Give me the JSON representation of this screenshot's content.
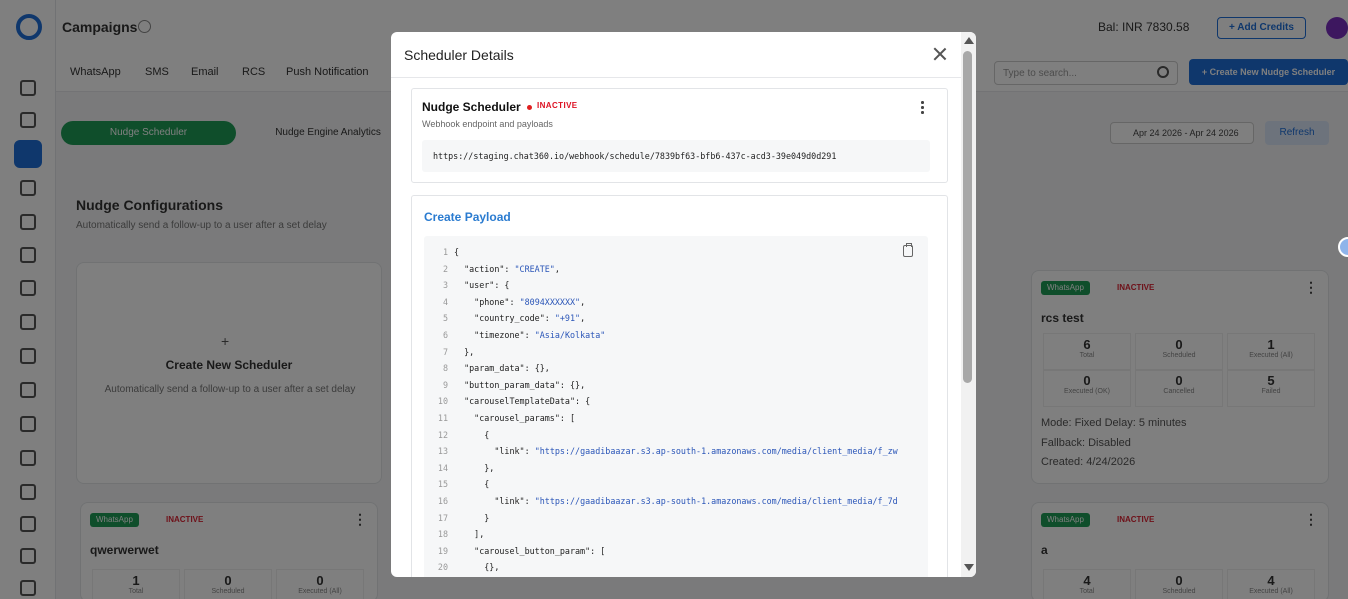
{
  "app": {
    "page_title": "Campaigns",
    "balance": "Bal: INR 7830.58",
    "add_credits": "+ Add Credits",
    "channel_tabs": [
      "WhatsApp",
      "SMS",
      "Email",
      "RCS",
      "Push Notification"
    ],
    "search_placeholder": "Type to search...",
    "create_button": "+ Create New Nudge Scheduler",
    "pill_tabs": [
      "Nudge Scheduler",
      "Nudge Engine Analytics"
    ],
    "date_range": "Apr 24 2026 - Apr 24 2026",
    "refresh": "Refresh",
    "section_title": "Nudge Configurations",
    "section_subtitle": "Automatically send a follow-up to a user after a set delay",
    "create_card": {
      "plus": "+",
      "title": "Create New Scheduler",
      "subtitle": "Automatically send a follow-up to a user after a set delay"
    },
    "cards": [
      {
        "channel": "WhatsApp",
        "status": "INACTIVE",
        "name": "rcs test",
        "stats": [
          {
            "value": "6",
            "label": "Total"
          },
          {
            "value": "0",
            "label": "Scheduled"
          },
          {
            "value": "1",
            "label": "Executed (All)"
          },
          {
            "value": "0",
            "label": "Executed (OK)"
          },
          {
            "value": "0",
            "label": "Cancelled"
          },
          {
            "value": "5",
            "label": "Failed"
          }
        ],
        "mode": "Mode: Fixed Delay: 5 minutes",
        "fallback": "Fallback: Disabled",
        "created": "Created: 4/24/2026"
      },
      {
        "channel": "WhatsApp",
        "status": "INACTIVE",
        "name": "qwerwerwet",
        "stats": [
          {
            "value": "1",
            "label": "Total"
          },
          {
            "value": "0",
            "label": "Scheduled"
          },
          {
            "value": "0",
            "label": "Executed (All)"
          }
        ]
      },
      {
        "channel": "WhatsApp",
        "status": "INACTIVE",
        "name": "a",
        "stats": [
          {
            "value": "4",
            "label": "Total"
          },
          {
            "value": "0",
            "label": "Scheduled"
          },
          {
            "value": "4",
            "label": "Executed (All)"
          }
        ]
      }
    ]
  },
  "modal": {
    "title": "Scheduler Details",
    "scheduler": {
      "name": "Nudge Scheduler",
      "status": "INACTIVE",
      "subtitle": "Webhook endpoint and payloads",
      "url": "https://staging.chat360.io/webhook/schedule/7839bf63-bfb6-437c-acd3-39e049d0d291"
    },
    "payload": {
      "title": "Create Payload",
      "lines": [
        {
          "n": "1",
          "t": [
            [
              "p",
              "{"
            ]
          ]
        },
        {
          "n": "2",
          "t": [
            [
              "k",
              "  \"action\": "
            ],
            [
              "s",
              "\"CREATE\""
            ],
            [
              "p",
              ","
            ]
          ]
        },
        {
          "n": "3",
          "t": [
            [
              "k",
              "  \"user\": "
            ],
            [
              "p",
              "{"
            ]
          ]
        },
        {
          "n": "4",
          "t": [
            [
              "k",
              "    \"phone\": "
            ],
            [
              "s",
              "\"8094XXXXXX\""
            ],
            [
              "p",
              ","
            ]
          ]
        },
        {
          "n": "5",
          "t": [
            [
              "k",
              "    \"country_code\": "
            ],
            [
              "s",
              "\"+91\""
            ],
            [
              "p",
              ","
            ]
          ]
        },
        {
          "n": "6",
          "t": [
            [
              "k",
              "    \"timezone\": "
            ],
            [
              "s",
              "\"Asia/Kolkata\""
            ]
          ]
        },
        {
          "n": "7",
          "t": [
            [
              "p",
              "  },"
            ]
          ]
        },
        {
          "n": "8",
          "t": [
            [
              "k",
              "  \"param_data\": "
            ],
            [
              "p",
              "{},"
            ]
          ]
        },
        {
          "n": "9",
          "t": [
            [
              "k",
              "  \"button_param_data\": "
            ],
            [
              "p",
              "{},"
            ]
          ]
        },
        {
          "n": "10",
          "t": [
            [
              "k",
              "  \"carouselTemplateData\": "
            ],
            [
              "p",
              "{"
            ]
          ]
        },
        {
          "n": "11",
          "t": [
            [
              "k",
              "    \"carousel_params\": "
            ],
            [
              "p",
              "["
            ]
          ]
        },
        {
          "n": "12",
          "t": [
            [
              "p",
              "      {"
            ]
          ]
        },
        {
          "n": "13",
          "t": [
            [
              "k",
              "        \"link\": "
            ],
            [
              "s",
              "\"https://gaadibaazar.s3.ap-south-1.amazonaws.com/media/client_media/f_zw"
            ]
          ]
        },
        {
          "n": "14",
          "t": [
            [
              "p",
              "      },"
            ]
          ]
        },
        {
          "n": "15",
          "t": [
            [
              "p",
              "      {"
            ]
          ]
        },
        {
          "n": "16",
          "t": [
            [
              "k",
              "        \"link\": "
            ],
            [
              "s",
              "\"https://gaadibaazar.s3.ap-south-1.amazonaws.com/media/client_media/f_7d"
            ]
          ]
        },
        {
          "n": "17",
          "t": [
            [
              "p",
              "      }"
            ]
          ]
        },
        {
          "n": "18",
          "t": [
            [
              "p",
              "    ],"
            ]
          ]
        },
        {
          "n": "19",
          "t": [
            [
              "k",
              "    \"carousel_button_param\": "
            ],
            [
              "p",
              "["
            ]
          ]
        },
        {
          "n": "20",
          "t": [
            [
              "p",
              "      {},"
            ]
          ]
        }
      ]
    }
  }
}
